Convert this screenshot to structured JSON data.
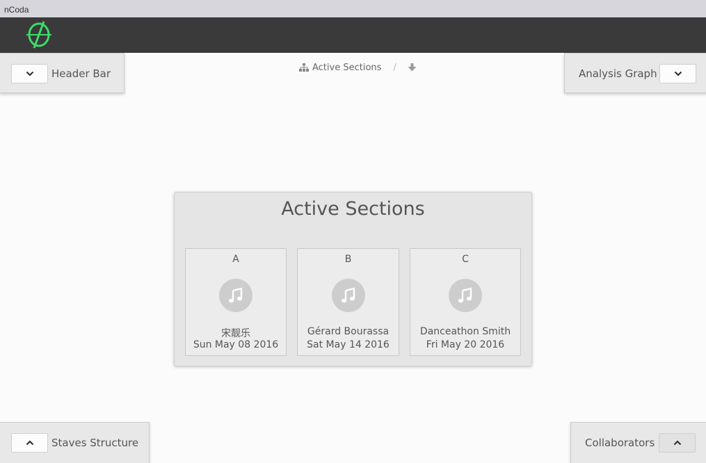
{
  "app": {
    "title": "nCoda"
  },
  "colors": {
    "header_bg": "#3a3a3a",
    "logo_green": "#3ddc6a",
    "panel_bg": "#e8e8e8",
    "card_bg": "#e5e5e5"
  },
  "panels": {
    "top_left": {
      "label": "Header Bar",
      "icon": "chevron-down-icon"
    },
    "top_right": {
      "label": "Analysis Graph",
      "icon": "chevron-down-icon"
    },
    "bottom_left": {
      "label": "Staves Structure",
      "icon": "chevron-up-icon"
    },
    "bottom_right": {
      "label": "Collaborators",
      "icon": "chevron-up-icon"
    }
  },
  "breadcrumb": {
    "icon": "sitemap-icon",
    "label": "Active Sections",
    "separator": "/",
    "download_icon": "arrow-down-icon"
  },
  "main": {
    "title": "Active Sections",
    "sections": [
      {
        "letter": "A",
        "author": "宋靓乐",
        "date": "Sun May 08 2016",
        "icon": "music-note-icon"
      },
      {
        "letter": "B",
        "author": "Gérard Bourassa",
        "date": "Sat May 14 2016",
        "icon": "music-note-icon"
      },
      {
        "letter": "C",
        "author": "Danceathon Smith",
        "date": "Fri May 20 2016",
        "icon": "music-note-icon"
      }
    ]
  }
}
